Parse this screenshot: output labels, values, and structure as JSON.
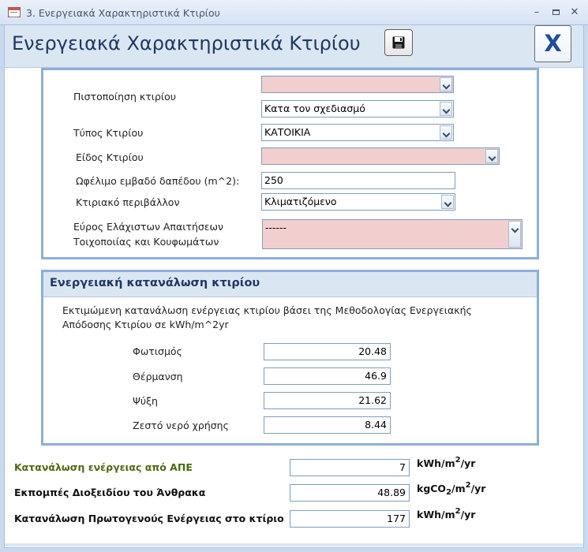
{
  "window": {
    "title": "3. Ενεργειακά Χαρακτηριστικά Κτιρίου"
  },
  "form": {
    "title": "Ενεργειακά Χαρακτηριστικά Κτιρίου",
    "close_label": "X"
  },
  "building": {
    "certification_label": "Πιστοποίηση κτιρίου",
    "certification_value": "",
    "certification_stage_value": "Κατα τον σχεδιασμό",
    "type_label": "Τύπος Κτιρίου",
    "type_value": "ΚΑΤΟΙΚΙΑ",
    "kind_label": "Είδος Κτιρίου",
    "kind_value": "",
    "area_label": "Ωφέλιμο εμβαδό δαπέδου (m^2):",
    "area_value": "250",
    "environment_label": "Κτιριακό περιβάλλον",
    "environment_value": "Κλιματιζόμενο",
    "range_label_1": "Εύρος Ελάχιστων Απαιτήσεων",
    "range_label_2": "Τοιχοποιίας και Κουφωμάτων",
    "range_value": "------"
  },
  "consumption": {
    "title": "Ενεργειακή κατανάλωση κτιρίου",
    "description": "Εκτιμώμενη κατανάλωση ενέργειας κτιρίου βάσει της Μεθοδολογίας Ενεργειακής Απόδοσης Κτιρίου σε kWh/m^2yr",
    "lighting_label": "Φωτισμός",
    "lighting_value": "20.48",
    "heating_label": "Θέρμανση",
    "heating_value": "46.9",
    "cooling_label": "Ψύξη",
    "cooling_value": "21.62",
    "hotwater_label": "Ζεστό νερό χρήσης",
    "hotwater_value": "8.44"
  },
  "totals": {
    "res_label": "Κατανάλωση ενέργειας από ΑΠΕ",
    "res_value": "7",
    "co2_label": "Εκπομπές Διοξειδίου του Άνθρακα",
    "co2_value": "48.89",
    "primary_label": "Κατανάλωση Πρωτογενούς Ενέργειας στο κτίριο",
    "primary_value": "177"
  },
  "colors": {
    "accent": "#1f3864",
    "border": "#8eaedb",
    "required": "#f2cfcf",
    "green_label": "#4b6a12"
  },
  "icons": {
    "save": "floppy-disk-icon",
    "close": "close-x-icon"
  }
}
